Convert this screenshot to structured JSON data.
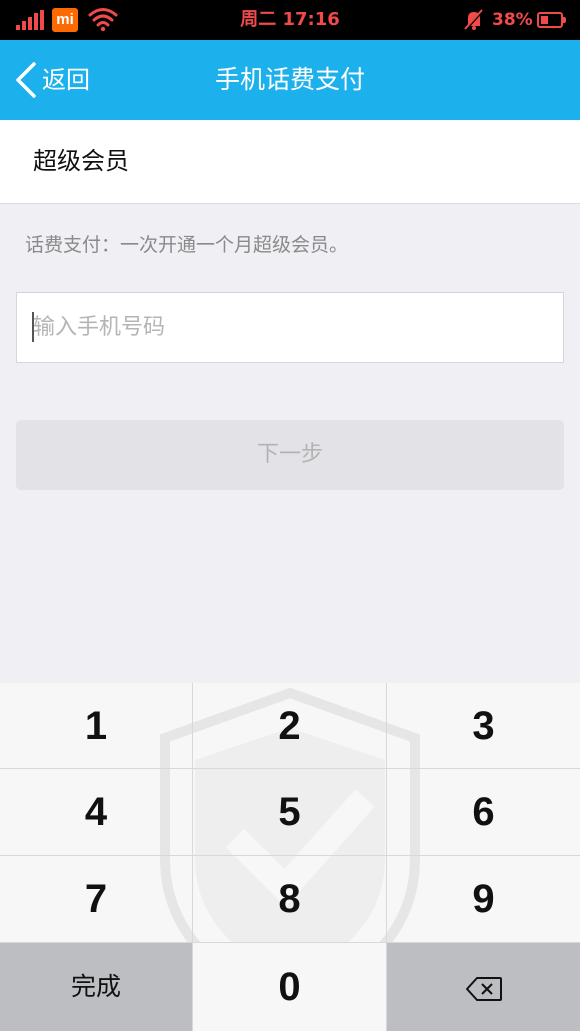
{
  "status_bar": {
    "carrier_icon": "mi-logo",
    "carrier_text": "mi",
    "time": "周二 17:16",
    "battery": "38%",
    "icons": [
      "signal-icon",
      "wifi-icon",
      "mute-icon",
      "battery-icon"
    ],
    "color": "#f04a4a"
  },
  "nav": {
    "back_label": "返回",
    "title": "手机话费支付",
    "background": "#1cb1ec"
  },
  "section": {
    "label": "超级会员"
  },
  "hint": "话费支付：一次开通一个月超级会员。",
  "phone_input": {
    "placeholder": "输入手机号码",
    "value": ""
  },
  "next_button": {
    "label": "下一步"
  },
  "keypad": {
    "keys": [
      "1",
      "2",
      "3",
      "4",
      "5",
      "6",
      "7",
      "8",
      "9"
    ],
    "done_label": "完成",
    "zero": "0",
    "delete_icon": "backspace-icon",
    "watermark_icon": "shield-check-icon"
  }
}
